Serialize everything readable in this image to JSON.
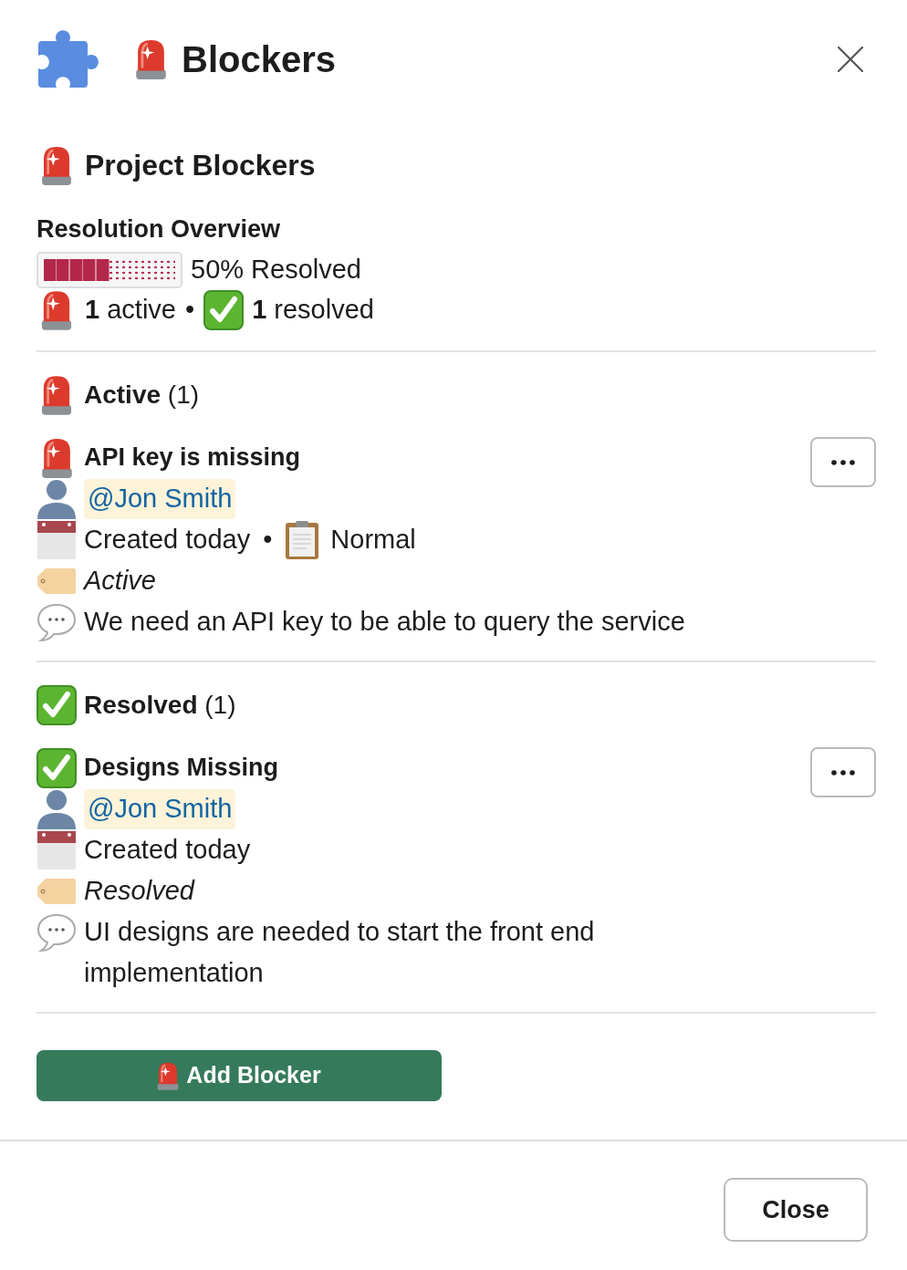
{
  "modal": {
    "title": "Blockers"
  },
  "section": {
    "title": "Project Blockers"
  },
  "overview": {
    "title": "Resolution Overview",
    "progress": {
      "level": 0.5,
      "reading": "50% Resolved"
    },
    "summary": [
      {
        "kind": "active",
        "text": "**1** active"
      },
      {
        "kind": "separator",
        "text": "•"
      },
      {
        "kind": "resolved",
        "text": "**1** resolved"
      }
    ]
  },
  "groups": [
    {
      "kind": "active",
      "heading": "**Active** (1)",
      "blockers": [
        {
          "kind": "active",
          "title": "API key is missing",
          "assignee": "@Jon Smith",
          "created": "Created today",
          "separator": "•",
          "priority": "Normal",
          "status": "Active",
          "description": "We need an API key to be able to query the service"
        }
      ]
    },
    {
      "kind": "resolved",
      "heading": "**Resolved** (1)",
      "blockers": [
        {
          "kind": "resolved",
          "title": "Designs Missing",
          "assignee": "@Jon Smith",
          "created": "Created today",
          "status": "Resolved",
          "description": "UI designs are needed to start the front end implementation"
        }
      ]
    }
  ],
  "add_button": {
    "label": "Add Blocker"
  },
  "footer": {
    "close_button": "Close"
  }
}
